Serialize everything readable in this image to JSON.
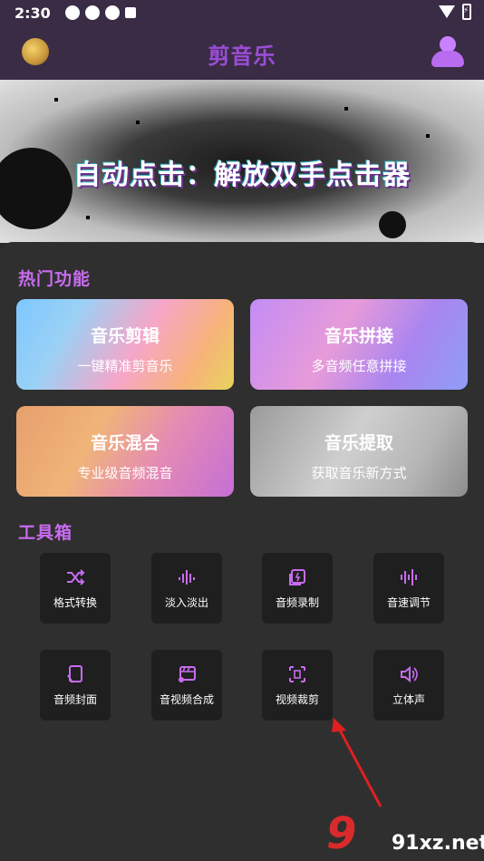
{
  "status": {
    "time": "2:30"
  },
  "app": {
    "title": "剪音乐"
  },
  "banner": {
    "text": "自动点击：解放双手点击器"
  },
  "hot": {
    "title": "热门功能",
    "cards": [
      {
        "title": "音乐剪辑",
        "subtitle": "一键精准剪音乐"
      },
      {
        "title": "音乐拼接",
        "subtitle": "多音频任意拼接"
      },
      {
        "title": "音乐混合",
        "subtitle": "专业级音频混音"
      },
      {
        "title": "音乐提取",
        "subtitle": "获取音乐新方式"
      }
    ]
  },
  "toolbox": {
    "title": "工具箱",
    "tools": [
      {
        "label": "格式转换",
        "icon": "shuffle-icon"
      },
      {
        "label": "淡入淡出",
        "icon": "fade-icon"
      },
      {
        "label": "音频录制",
        "icon": "record-icon"
      },
      {
        "label": "音速调节",
        "icon": "speed-icon"
      },
      {
        "label": "音频封面",
        "icon": "cover-icon"
      },
      {
        "label": "音视频合成",
        "icon": "merge-icon"
      },
      {
        "label": "视频裁剪",
        "icon": "crop-icon"
      },
      {
        "label": "立体声",
        "icon": "stereo-icon"
      }
    ]
  },
  "watermark": {
    "mark": "9",
    "site": "91xz.net"
  },
  "colors": {
    "accent": "#c86cf0",
    "arrow": "#e02020"
  }
}
